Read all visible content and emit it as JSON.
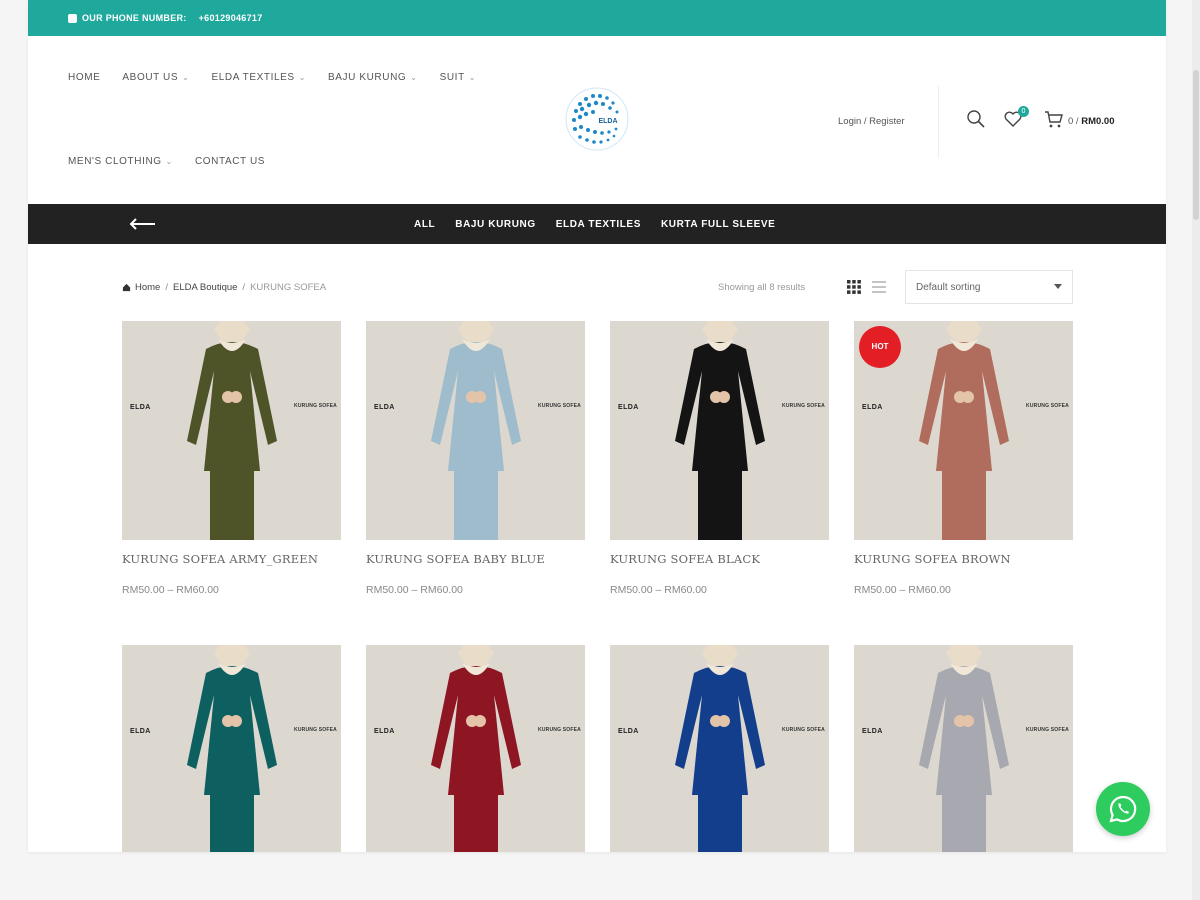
{
  "topbar": {
    "phone_label": "OUR PHONE NUMBER:",
    "phone_number": "+60129046717"
  },
  "nav": {
    "row1": [
      {
        "label": "HOME",
        "dropdown": false
      },
      {
        "label": "ABOUT US",
        "dropdown": true
      },
      {
        "label": "ELDA TEXTILES",
        "dropdown": true
      },
      {
        "label": "BAJU KURUNG",
        "dropdown": true
      },
      {
        "label": "SUIT",
        "dropdown": true
      }
    ],
    "row2": [
      {
        "label": "MEN'S CLOTHING",
        "dropdown": true
      },
      {
        "label": "CONTACT US",
        "dropdown": false
      }
    ]
  },
  "logo": {
    "text": "ELDA"
  },
  "header": {
    "login_label": "Login / Register",
    "wishlist_count": "0",
    "cart_count": "0",
    "cart_total": "RM0.00"
  },
  "categories": [
    "ALL",
    "BAJU KURUNG",
    "ELDA TEXTILES",
    "KURTA FULL SLEEVE"
  ],
  "breadcrumb": {
    "home": "Home",
    "parent": "ELDA Boutique",
    "current": "KURUNG SOFEA"
  },
  "results_text": "Showing all 8 results",
  "sort": {
    "selected": "Default sorting"
  },
  "products": [
    {
      "name": "KURUNG SOFEA ARMY_GREEN",
      "price": "RM50.00 – RM60.00",
      "color": "#4f5328",
      "hot": false
    },
    {
      "name": "KURUNG SOFEA BABY BLUE",
      "price": "RM50.00 – RM60.00",
      "color": "#9fbccc",
      "hot": false
    },
    {
      "name": "KURUNG SOFEA BLACK",
      "price": "RM50.00 – RM60.00",
      "color": "#141414",
      "hot": false
    },
    {
      "name": "KURUNG SOFEA BROWN",
      "price": "RM50.00 – RM60.00",
      "color": "#b06c5c",
      "hot": true
    },
    {
      "name": "",
      "price": "",
      "color": "#0e5f60",
      "hot": false
    },
    {
      "name": "",
      "price": "",
      "color": "#8e1622",
      "hot": false
    },
    {
      "name": "",
      "price": "",
      "color": "#123e8c",
      "hot": false
    },
    {
      "name": "",
      "price": "",
      "color": "#a8a9b0",
      "hot": false
    }
  ],
  "product_labels": {
    "brand": "ELDA",
    "collection": "KURUNG SOFEA",
    "hot": "HOT"
  },
  "colors": {
    "accent": "#1fa99d",
    "dark_bar": "#222222",
    "hot_badge": "#e31e24",
    "whatsapp": "#2ecc5f"
  }
}
